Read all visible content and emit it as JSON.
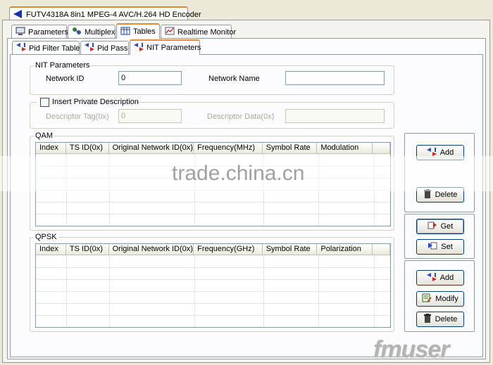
{
  "window": {
    "title": "FUTV4318A 8in1 MPEG-4 AVC/H.264 HD Encoder"
  },
  "main_tabs": [
    {
      "label": "Parameters",
      "icon": "monitor-icon"
    },
    {
      "label": "Multiplex",
      "icon": "network-icon"
    },
    {
      "label": "Tables",
      "icon": "table-icon"
    },
    {
      "label": "Realtime Monitor",
      "icon": "chart-icon"
    }
  ],
  "sub_tabs": [
    {
      "label": "Pid Filter Table",
      "icon": "arrows-icon"
    },
    {
      "label": "Pid Pass",
      "icon": "arrows-icon"
    },
    {
      "label": "NIT Parameters",
      "icon": "arrows-icon"
    }
  ],
  "nit": {
    "group_label": "NIT Parameters",
    "network_id_label": "Network ID",
    "network_id_value": "0",
    "network_name_label": "Network Name",
    "network_name_value": ""
  },
  "private_desc": {
    "checkbox_label": "Insert Private Description",
    "checked": false,
    "tag_label": "Descriptor Tag(0x)",
    "tag_value": "0",
    "data_label": "Descriptor Data(0x)",
    "data_value": ""
  },
  "qam": {
    "group_label": "QAM",
    "columns": [
      "Index",
      "TS ID(0x)",
      "Original Network ID(0x)",
      "Frequency(MHz)",
      "Symbol Rate",
      "Modulation"
    ],
    "rows": []
  },
  "qpsk": {
    "group_label": "QPSK",
    "columns": [
      "Index",
      "TS ID(0x)",
      "Original Network ID(0x)",
      "Frequency(GHz)",
      "Symbol Rate",
      "Polarization"
    ],
    "rows": []
  },
  "buttons": {
    "qam_add": "Add",
    "qam_delete": "Delete",
    "get": "Get",
    "set": "Set",
    "qpsk_add": "Add",
    "qpsk_modify": "Modify",
    "qpsk_delete": "Delete"
  },
  "watermark": {
    "text": "trade.china.cn",
    "logo": "fmuser"
  },
  "colors": {
    "tab_accent": "#e68b2c",
    "border": "#919b9c",
    "input_border": "#7f9db9"
  }
}
